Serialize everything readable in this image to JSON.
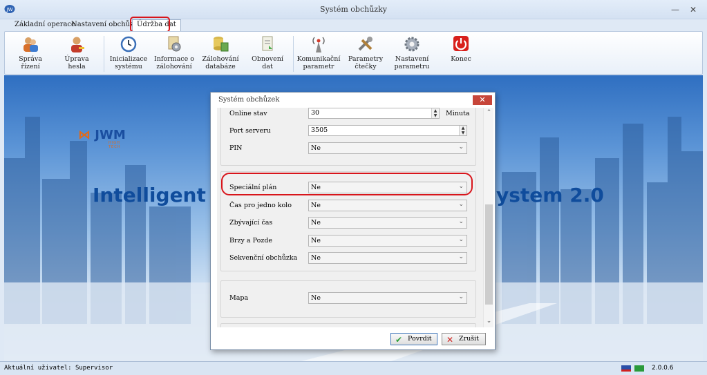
{
  "window": {
    "title": "Systém obchůzky"
  },
  "tabs": [
    {
      "label": "Základní operace"
    },
    {
      "label": "Nastavení obchůzek"
    },
    {
      "label": "Údržba dat"
    }
  ],
  "ribbon": [
    {
      "label1": "Správa",
      "label2": "řízení",
      "icon": "users-icon"
    },
    {
      "label1": "Úprava",
      "label2": "hesla",
      "icon": "user-edit-icon"
    },
    {
      "label1": "Inicializace",
      "label2": "systému",
      "icon": "clock-reset-icon"
    },
    {
      "label1": "Informace o",
      "label2": "zálohování",
      "icon": "gear-info-icon"
    },
    {
      "label1": "Zálohování",
      "label2": "databáze",
      "icon": "database-backup-icon"
    },
    {
      "label1": "Obnovení",
      "label2": "dat",
      "icon": "restore-doc-icon"
    },
    {
      "label1": "Komunikační",
      "label2": "parametr",
      "icon": "antenna-icon"
    },
    {
      "label1": "Parametry",
      "label2": "čtečky",
      "icon": "tools-icon"
    },
    {
      "label1": "Nastavení",
      "label2": "parametru",
      "icon": "settings-gear-icon"
    },
    {
      "label1": "Konec",
      "label2": "",
      "icon": "power-icon"
    }
  ],
  "banner": {
    "logo": "JWM",
    "logo_sub": "HIGH TECH",
    "text_left": "Intelligent",
    "text_right": "ystem 2.0"
  },
  "dialog": {
    "title": "Systém obchůzek",
    "close": "✕",
    "online": {
      "label": "Online stav",
      "value": "30",
      "unit": "Minuta"
    },
    "port": {
      "label": "Port serveru",
      "value": "3505"
    },
    "pin": {
      "label": "PIN",
      "value": "Ne"
    },
    "special": {
      "label": "Speciální plán",
      "value": "Ne"
    },
    "round_time": {
      "label": "Čas pro jedno kolo",
      "value": "Ne"
    },
    "remaining": {
      "label": "Zbývající čas",
      "value": "Ne"
    },
    "early_late": {
      "label": "Brzy a Pozde",
      "value": "Ne"
    },
    "sequential": {
      "label": "Sekvenční obchůzka",
      "value": "Ne"
    },
    "map": {
      "label": "Mapa",
      "value": "Ne"
    },
    "confirm": "Povrdit",
    "cancel": "Zrušit"
  },
  "status": {
    "user": "Aktuální uživatel: Supervisor",
    "version": "2.0.0.6"
  },
  "colors": {
    "highlight": "#d8151b",
    "brand": "#0f4c9c",
    "accent": "#e26a1a"
  }
}
